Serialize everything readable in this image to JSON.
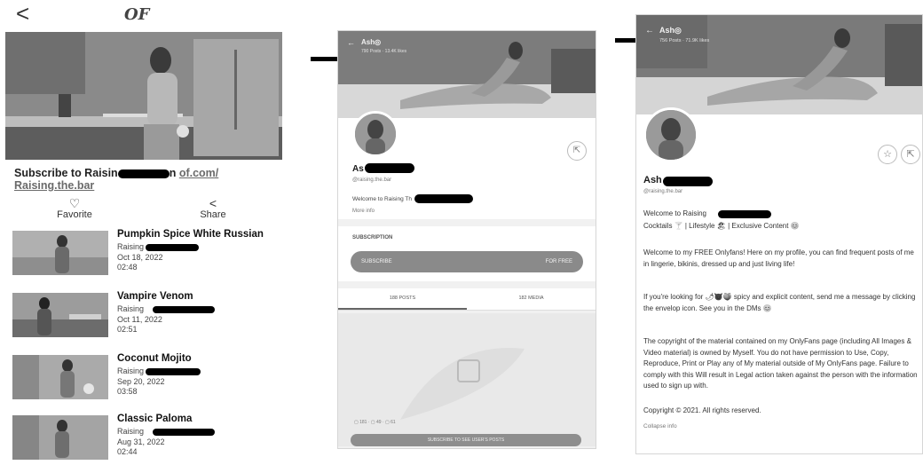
{
  "panel1": {
    "back_icon": "chevron-left-icon",
    "back": "<",
    "logo": "OF",
    "subscribe_prefix": "Subscribe to Raisin",
    "subscribe_mid": "n",
    "subscribe_link": "of.com/",
    "subscribe_link2": "Raising.the.bar",
    "favorite_icon": "♡",
    "favorite_label": "Favorite",
    "share_icon": "<",
    "share_label": "Share",
    "videos": [
      {
        "title": "Pumpkin Spice White Russian",
        "channel": "Raising",
        "date": "Oct 18, 2022",
        "duration": "02:48"
      },
      {
        "title": "Vampire Venom",
        "channel": "Raising",
        "date": "Oct 11, 2022",
        "duration": "02:51"
      },
      {
        "title": "Coconut Mojito",
        "channel": "Raising",
        "date": "Sep 20, 2022",
        "duration": "03:58"
      },
      {
        "title": "Classic Paloma",
        "channel": "Raising",
        "date": "Aug 31, 2022",
        "duration": "02:44"
      }
    ]
  },
  "panel2": {
    "header_name": "Ash◎",
    "header_stats": "790 Posts · 13.4K likes",
    "name": "As",
    "handle": "@raising.the.bar",
    "bio": "Welcome to Raising Th",
    "more_info": "More info",
    "subscription_label": "SUBSCRIPTION",
    "subscribe_button": "SUBSCRIBE",
    "subscribe_price": "FOR FREE",
    "tab_posts": "188 POSTS",
    "tab_media": "182 MEDIA",
    "locked_counts": "▢ 181 · ▢ 49 · ▢ 61",
    "locked_button": "SUBSCRIBE TO SEE USER'S POSTS"
  },
  "panel3": {
    "header_name": "Ash◎",
    "header_stats": "756 Posts · 71.9K likes",
    "name": "Ash",
    "handle": "@raising.the.bar",
    "welcome": "Welcome to Raising",
    "tags": "Cocktails 🍸 | Lifestyle 🏖 | Exclusive Content 😊",
    "para1": "Welcome to my FREE Onlyfans! Here on my profile, you can find frequent posts of me in lingerie, bikinis, dressed up and just living life!",
    "para2": "If you're looking for 🌶😈🍑 spicy and explicit content, send me a message by clicking the envelop icon. See you in the DMs 😊",
    "para3": "The copyright of the material contained on my OnlyFans page (including All Images & Video material) is owned by Myself. You do not have permission to Use, Copy, Reproduce, Print or Play any of My material outside of My OnlyFans page. Failure to comply with this Will result in Legal action taken against the person with the information used to sign up with.",
    "copyright": "Copyright © 2021. All rights reserved.",
    "collapse": "Collapse info",
    "star": "☆",
    "share": "⇱"
  }
}
